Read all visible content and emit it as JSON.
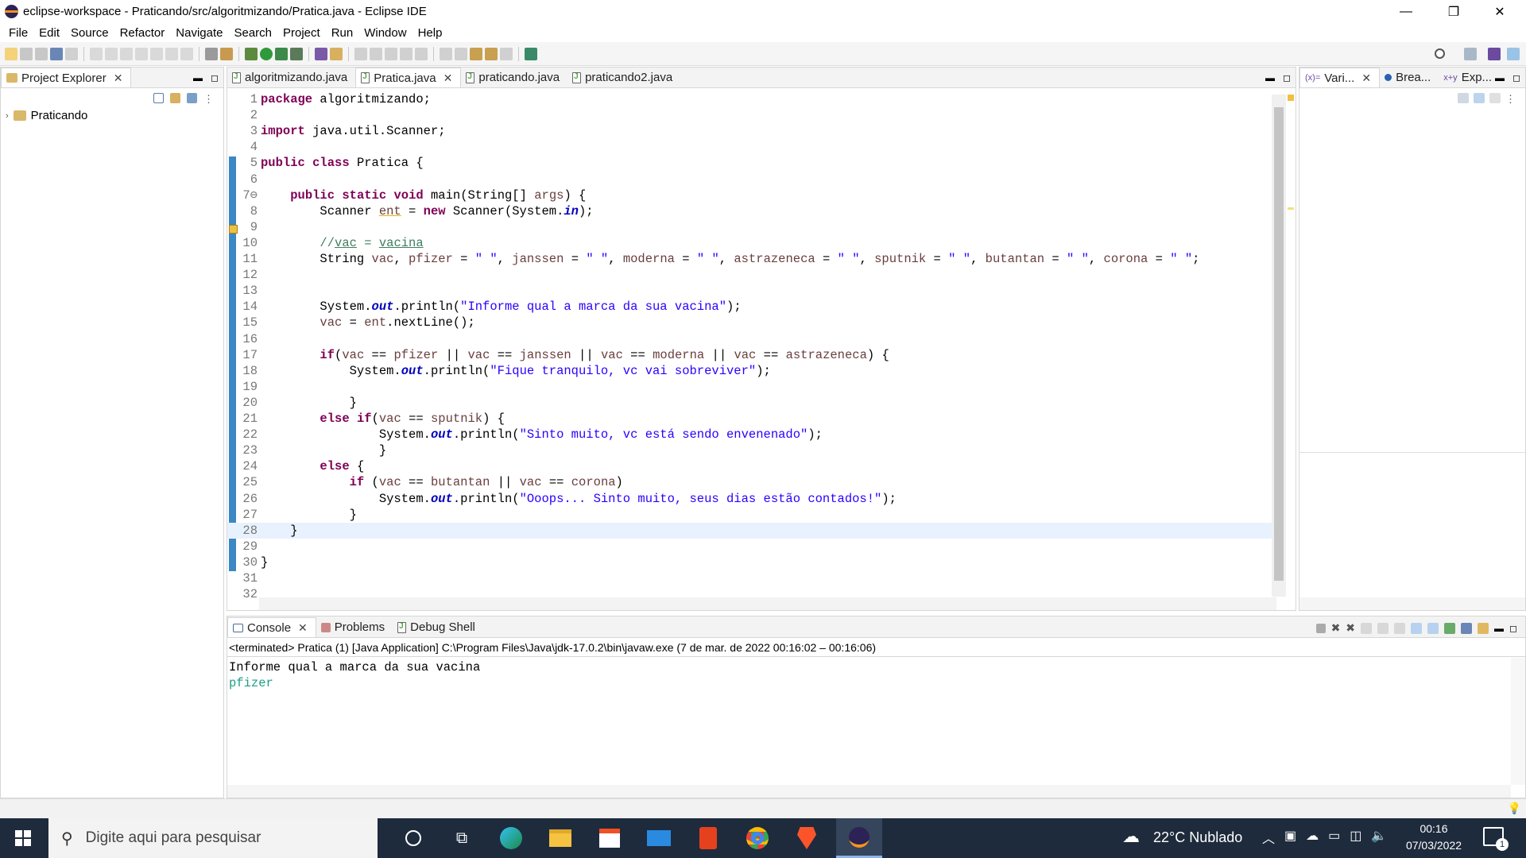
{
  "window": {
    "title": "eclipse-workspace - Praticando/src/algoritmizando/Pratica.java - Eclipse IDE",
    "minimize": "—",
    "restore": "❐",
    "close": "✕"
  },
  "menu": [
    "File",
    "Edit",
    "Source",
    "Refactor",
    "Navigate",
    "Search",
    "Project",
    "Run",
    "Window",
    "Help"
  ],
  "explorer": {
    "tab_label": "Project Explorer",
    "tree": [
      {
        "label": "Praticando"
      }
    ]
  },
  "editor": {
    "tabs": [
      {
        "label": "algoritmizando.java",
        "active": false
      },
      {
        "label": "Pratica.java",
        "active": true
      },
      {
        "label": "praticando.java",
        "active": false
      },
      {
        "label": "praticando2.java",
        "active": false
      }
    ],
    "lines": [
      {
        "n": "1",
        "html": "<span class='kw'>package</span> algoritmizando;"
      },
      {
        "n": "2",
        "html": ""
      },
      {
        "n": "3",
        "html": "<span class='kw'>import</span> java.util.Scanner;"
      },
      {
        "n": "4",
        "html": ""
      },
      {
        "n": "5",
        "html": "<span class='kw'>public</span> <span class='kw'>class</span> Pratica {"
      },
      {
        "n": "6",
        "html": ""
      },
      {
        "n": "7⊖",
        "html": "    <span class='kw'>public</span> <span class='kw'>static</span> <span class='kw'>void</span> main(String[] <span class='var'>args</span>) {"
      },
      {
        "n": "8",
        "html": "        Scanner <span class='var ul'>ent</span> = <span class='kw'>new</span> Scanner(System.<span class='fld'>in</span>);"
      },
      {
        "n": "9",
        "html": ""
      },
      {
        "n": "10",
        "html": "        <span class='cmt'>//<u>vac</u> = <u>vacina</u></span>"
      },
      {
        "n": "11",
        "html": "        String <span class='var'>vac</span>, <span class='var'>pfizer</span> = <span class='str'>\" \"</span>, <span class='var'>janssen</span> = <span class='str'>\" \"</span>, <span class='var'>moderna</span> = <span class='str'>\" \"</span>, <span class='var'>astrazeneca</span> = <span class='str'>\" \"</span>, <span class='var'>sputnik</span> = <span class='str'>\" \"</span>, <span class='var'>butantan</span> = <span class='str'>\" \"</span>, <span class='var'>corona</span> = <span class='str'>\" \"</span>;"
      },
      {
        "n": "12",
        "html": ""
      },
      {
        "n": "13",
        "html": ""
      },
      {
        "n": "14",
        "html": "        System.<span class='fld'>out</span>.println(<span class='str'>\"Informe qual a marca da sua vacina\"</span>);"
      },
      {
        "n": "15",
        "html": "        <span class='var'>vac</span> = <span class='var'>ent</span>.nextLine();"
      },
      {
        "n": "16",
        "html": ""
      },
      {
        "n": "17",
        "html": "        <span class='kw'>if</span>(<span class='var'>vac</span> == <span class='var'>pfizer</span> || <span class='var'>vac</span> == <span class='var'>janssen</span> || <span class='var'>vac</span> == <span class='var'>moderna</span> || <span class='var'>vac</span> == <span class='var'>astrazeneca</span>) {"
      },
      {
        "n": "18",
        "html": "            System.<span class='fld'>out</span>.println(<span class='str'>\"Fique tranquilo, vc vai sobreviver\"</span>);"
      },
      {
        "n": "19",
        "html": ""
      },
      {
        "n": "20",
        "html": "            }"
      },
      {
        "n": "21",
        "html": "        <span class='kw'>else</span> <span class='kw'>if</span>(<span class='var'>vac</span> == <span class='var'>sputnik</span>) {"
      },
      {
        "n": "22",
        "html": "                System.<span class='fld'>out</span>.println(<span class='str'>\"Sinto muito, vc está sendo envenenado\"</span>);"
      },
      {
        "n": "23",
        "html": "                }"
      },
      {
        "n": "24",
        "html": "        <span class='kw'>else</span> {"
      },
      {
        "n": "25",
        "html": "            <span class='kw'>if</span> (<span class='var'>vac</span> == <span class='var'>butantan</span> || <span class='var'>vac</span> == <span class='var'>corona</span>)"
      },
      {
        "n": "26",
        "html": "                System.<span class='fld'>out</span>.println(<span class='str'>\"Ooops... Sinto muito, seus dias estão contados!\"</span>);"
      },
      {
        "n": "27",
        "html": "            }"
      },
      {
        "n": "28",
        "html": "    }"
      },
      {
        "n": "29",
        "html": ""
      },
      {
        "n": "30",
        "html": "}"
      },
      {
        "n": "31",
        "html": ""
      },
      {
        "n": "32",
        "html": ""
      }
    ],
    "highlight_line": "28"
  },
  "right_panel": {
    "tabs": [
      {
        "label": "Vari..."
      },
      {
        "label": "Brea..."
      },
      {
        "label": "Exp..."
      }
    ]
  },
  "console": {
    "tabs": [
      {
        "label": "Console"
      },
      {
        "label": "Problems"
      },
      {
        "label": "Debug Shell"
      }
    ],
    "header": "<terminated> Pratica (1) [Java Application] C:\\Program Files\\Java\\jdk-17.0.2\\bin\\javaw.exe  (7 de mar. de 2022 00:16:02 – 00:16:06)",
    "output": "Informe qual a marca da sua vacina",
    "input": "pfizer",
    "input_color": "#1e9e86"
  },
  "taskbar": {
    "search_placeholder": "Digite aqui para pesquisar",
    "weather": "22°C  Nublado",
    "time": "00:16",
    "date": "07/03/2022",
    "notifications": "1"
  }
}
